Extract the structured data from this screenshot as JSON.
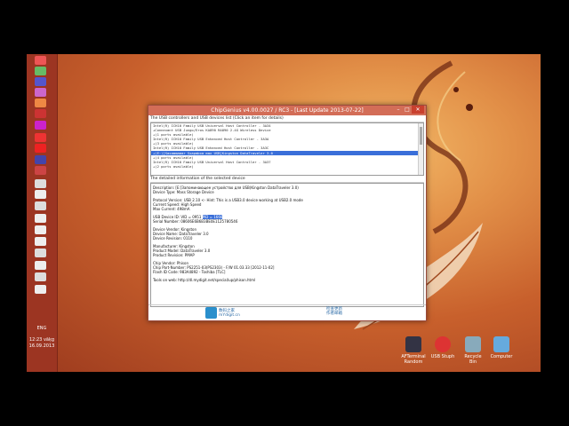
{
  "window": {
    "title": "ChipGenius v4.00.0027 / RC3 - [Last Update 2013-07-22]",
    "section_devices": "The USB controllers and USB devices list (Click an item for details)",
    "section_details": "The detailed information of the selected device"
  },
  "devices": [
    "Intel(R) ICH10 Family USB Universal Host Controller - 3A34",
    "+Connexant USB Jungo/Eros KA890 RA890 2.4G Wireless Device",
    "+(1 ports available)",
    "Intel(R) ICH10 Family USB Enhanced Host Controller - 3A3A",
    "+(3 ports available)",
    "Intel(R) ICH10 Family USB Enhanced Host Controller - 3A3C",
    "+(E:)[Saxammamar Sxapmbxa max USB]Kingston DataTraveler 3.0",
    "+(4 ports available)",
    "Intel(R) ICH10 Family USB Universal Host Controller - 3A37",
    "+(2 ports available)"
  ],
  "details": {
    "description": "Description: [E:]Запоминающее устройство для USB(Kingston DataTraveler 3.0)",
    "device_type": "Device Type:  Mass Storage Device",
    "protocol": "Protocol Version: USB 2.10 <- Hint: This is a USB3.0 device working at USB2.0 mode",
    "current_speed": "Current Speed: High Speed",
    "max_current": "Max Current: 498mA",
    "usb_id_label": "USB Device ID: VID = 0951 ",
    "usb_id_pid": "PID = 1666",
    "serial": "Serial Number: 08606E6B6B3BE0E1125780546",
    "device_vendor": "Device Vendor: Kingston",
    "device_name": "Device Name: DataTraveler 3.0",
    "device_revision": "Device Revision: 0110",
    "manufacturer": "Manufacturer: Kingston",
    "product_model": "Product Model: DataTraveler 3.0",
    "product_revision": "Product Revision: PMAP",
    "chip_vendor": "Chip Vendor: Phison",
    "chip_part": "Chip Part-Number: PS2251-03(PS2303) - F/W 01.03.33 [2012-11-02]",
    "flash_id": "Flash ID Code: 983A4892 - Toshiba [TLC]",
    "tools": "Tools on web: http://dl.mydigit.net/special/up/phison.html"
  },
  "footer": {
    "logo_text": "数码之家",
    "logo_sub": "mYdigit.cn",
    "link1": "检查更新",
    "link2": "作者邮箱"
  },
  "taskbar": {
    "lang": "ENG",
    "time": "12:23 vāķg",
    "date": "16.09.2013"
  },
  "desktop_icons": [
    {
      "label": "AFTerminal Random",
      "color": "#334"
    },
    {
      "label": "USB Stuph",
      "color": "#d33"
    },
    {
      "label": "Recycle Bin",
      "color": "#8ab"
    },
    {
      "label": "Computer",
      "color": "#6ad"
    }
  ]
}
